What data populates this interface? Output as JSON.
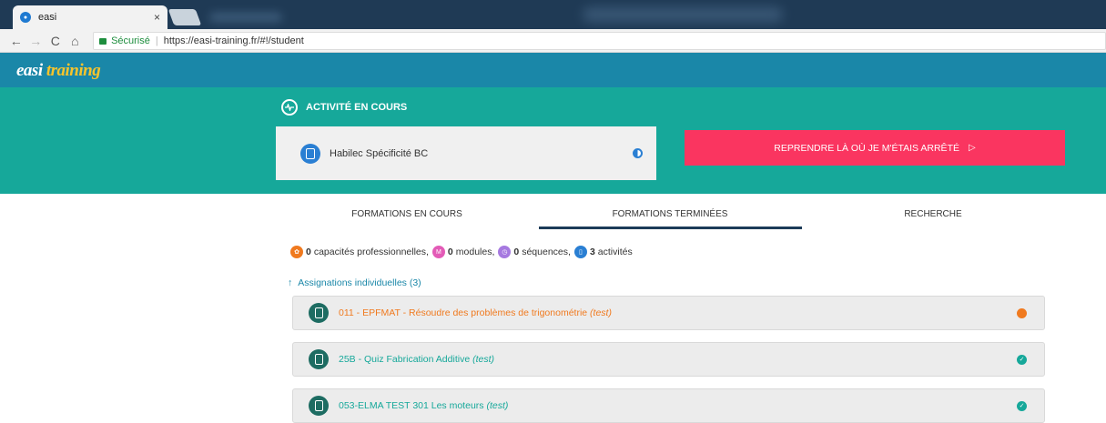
{
  "browser": {
    "tab_title": "easi",
    "tab_close": "×",
    "back": "←",
    "forward": "→",
    "reload": "C",
    "home": "⌂",
    "secure_label": "Sécurisé",
    "separator": "|",
    "url": "https://easi-training.fr/#!/student"
  },
  "app": {
    "logo_part1": "easi ",
    "logo_part2": "training"
  },
  "current_activity": {
    "heading": "ACTIVITÉ EN COURS",
    "name": "Habilec Spécificité BC",
    "resume_label": "REPRENDRE LÀ OÙ JE M'ÉTAIS ARRÊTÉ",
    "resume_icon": "▷"
  },
  "tabs": {
    "in_progress": "FORMATIONS EN COURS",
    "finished": "FORMATIONS TERMINÉES",
    "search": "RECHERCHE",
    "active": "finished"
  },
  "stats": {
    "capacities_count": "0",
    "capacities_label": "capacités professionnelles,",
    "modules_count": "0",
    "modules_label": "modules,",
    "sequences_count": "0",
    "sequences_label": "séquences,",
    "activities_count": "3",
    "activities_label": "activités"
  },
  "assignments": {
    "arrow": "↑",
    "label": "Assignations individuelles (3)"
  },
  "rows": [
    {
      "title": "011 - EPFMAT - Résoudre des problèmes de trigonométrie ",
      "tag": "(test)",
      "color": "#f07a1f",
      "status": "in-progress"
    },
    {
      "title": "25B - Quiz Fabrication Additive ",
      "tag": "(test)",
      "color": "#16a89a",
      "status": "completed"
    },
    {
      "title": "053-ELMA TEST 301 Les moteurs ",
      "tag": "(test)",
      "color": "#16a89a",
      "status": "completed"
    }
  ],
  "colors": {
    "header": "#1a87a8",
    "banner": "#16a89a",
    "resume": "#fa3560",
    "tab_underline": "#1c3b58",
    "pending": "#f07a1f",
    "done": "#16a89a"
  }
}
